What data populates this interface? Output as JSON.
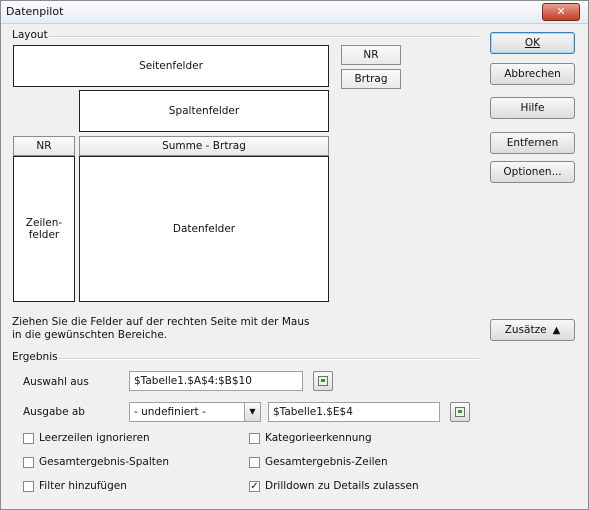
{
  "window": {
    "title": "Datenpilot",
    "close_glyph": "✕"
  },
  "layout": {
    "group_label": "Layout",
    "page_fields_label": "Seitenfelder",
    "column_fields_label": "Spaltenfelder",
    "row_fields_label_line1": "Zeilen-",
    "row_fields_label_line2": "felder",
    "data_fields_label": "Datenfelder",
    "row_field_button": "NR",
    "data_field_button": "Summe - Brtrag",
    "available_fields": [
      "NR",
      "Brtrag"
    ],
    "hint": "Ziehen Sie die Felder auf der rechten Seite mit der Maus in die gewünschten Bereiche."
  },
  "buttons": {
    "ok": "OK",
    "cancel": "Abbrechen",
    "help": "Hilfe",
    "remove": "Entfernen",
    "options": "Optionen...",
    "more": "Zusätze",
    "more_icon": "▲"
  },
  "result": {
    "group_label": "Ergebnis",
    "selection_from_label": "Auswahl aus",
    "selection_from_value": "$Tabelle1.$A$4:$B$10",
    "output_to_label": "Ausgabe ab",
    "output_select_value": "- undefiniert -",
    "output_to_value": "$Tabelle1.$E$4"
  },
  "options": [
    {
      "label": "Leerzeilen ignorieren",
      "checked": false
    },
    {
      "label": "Kategorieerkennung",
      "checked": false
    },
    {
      "label": "Gesamtergebnis-Spalten",
      "checked": false
    },
    {
      "label": "Gesamtergebnis-Zeilen",
      "checked": false
    },
    {
      "label": "Filter hinzufügen",
      "checked": false
    },
    {
      "label": "Drilldown zu Details zulassen",
      "checked": true
    }
  ]
}
